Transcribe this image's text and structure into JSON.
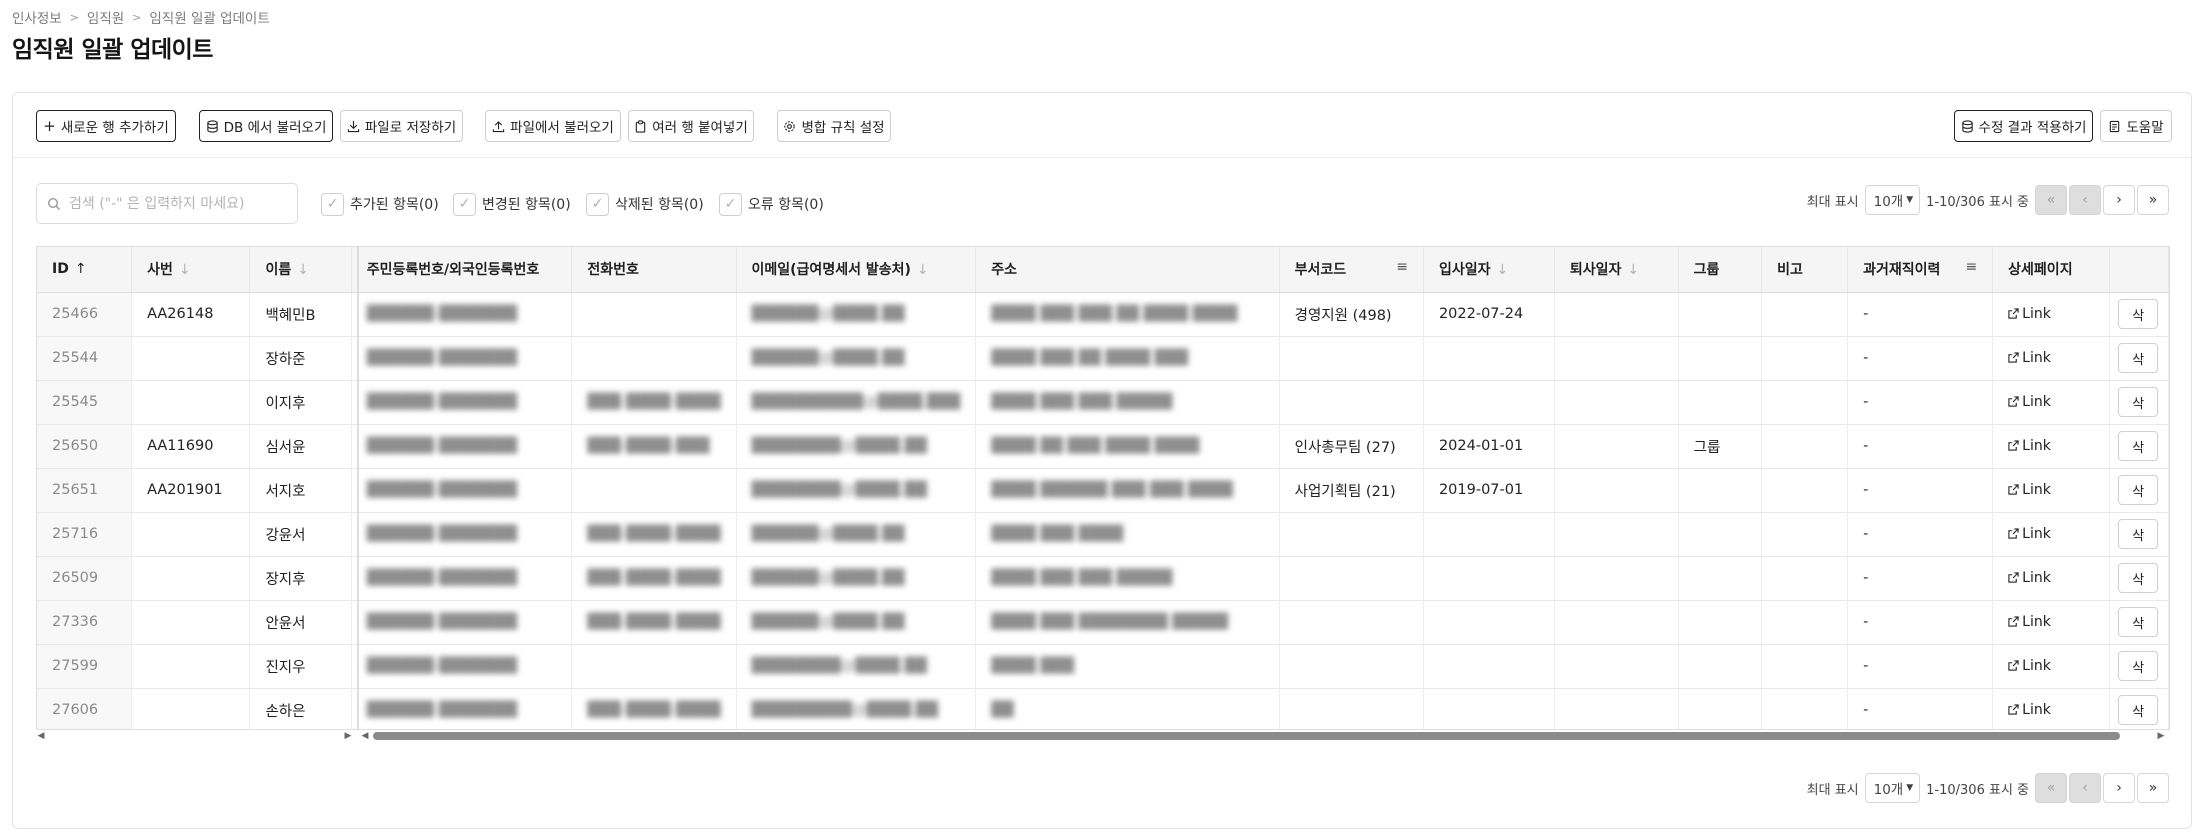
{
  "breadcrumb": [
    "인사정보",
    "임직원",
    "임직원 일괄 업데이트"
  ],
  "page_title": "임직원 일괄 업데이트",
  "toolbar": {
    "add_row": "새로운 행 추가하기",
    "load_db": "DB 에서 불러오기",
    "save_file": "파일로 저장하기",
    "load_file": "파일에서 불러오기",
    "paste_rows": "여러 행 붙여넣기",
    "merge_rules": "병합 규칙 설정",
    "apply": "수정 결과 적용하기",
    "help": "도움말"
  },
  "search": {
    "placeholder": "검색 (\"-\" 은 입력하지 마세요)"
  },
  "filters": {
    "added": "추가된 항목(0)",
    "changed": "변경된 항목(0)",
    "deleted": "삭제된 항목(0)",
    "error": "오류 항목(0)"
  },
  "pager": {
    "label": "최대 표시",
    "page_size": "10개",
    "range": "1-10/306 표시 중"
  },
  "columns": {
    "id": "ID",
    "sabun": "사번",
    "name": "이름",
    "rrn": "주민등록번호/외국인등록번호",
    "phone": "전화번호",
    "email": "이메일(급여명세서 발송처)",
    "address": "주소",
    "dept": "부서코드",
    "join": "입사일자",
    "leave": "퇴사일자",
    "group": "그룹",
    "note": "비고",
    "history": "과거재직이력",
    "detail": "상세페이지"
  },
  "rows": [
    {
      "id": "25466",
      "sabun": "AA26148",
      "name": "백혜민B",
      "rrn": "██████-███████",
      "phone": "",
      "email": "██████@████.██",
      "address": "████ ███ ███ ██ ████ ████",
      "dept": "경영지원 (498)",
      "join": "2022-07-24",
      "leave": "",
      "group": "",
      "note": "",
      "history": "-",
      "link": "Link"
    },
    {
      "id": "25544",
      "sabun": "",
      "name": "장하준",
      "rrn": "██████-███████",
      "phone": "",
      "email": "██████@████.██",
      "address": "████ ███ ██ ████ ███",
      "dept": "",
      "join": "",
      "leave": "",
      "group": "",
      "note": "",
      "history": "-",
      "link": "Link"
    },
    {
      "id": "25545",
      "sabun": "",
      "name": "이지후",
      "rrn": "██████-███████",
      "phone": "███-████-████",
      "email": "██████████@████.███",
      "address": "████ ███ ███ █████",
      "dept": "",
      "join": "",
      "leave": "",
      "group": "",
      "note": "",
      "history": "-",
      "link": "Link"
    },
    {
      "id": "25650",
      "sabun": "AA11690",
      "name": "심서윤",
      "rrn": "██████-███████",
      "phone": "███-████-███",
      "email": "████████@████.██",
      "address": "████ ██ ███ ████ ████",
      "dept": "인사총무팀 (27)",
      "join": "2024-01-01",
      "leave": "",
      "group": "그룹",
      "note": "",
      "history": "-",
      "link": "Link"
    },
    {
      "id": "25651",
      "sabun": "AA201901",
      "name": "서지호",
      "rrn": "██████-███████",
      "phone": "",
      "email": "████████@████.██",
      "address": "████ ██████ ███ ███ ████",
      "dept": "사업기획팀 (21)",
      "join": "2019-07-01",
      "leave": "",
      "group": "",
      "note": "",
      "history": "-",
      "link": "Link"
    },
    {
      "id": "25716",
      "sabun": "",
      "name": "강윤서",
      "rrn": "██████-███████",
      "phone": "███-████-████",
      "email": "██████@████.██",
      "address": "████ ███ ████",
      "dept": "",
      "join": "",
      "leave": "",
      "group": "",
      "note": "",
      "history": "-",
      "link": "Link"
    },
    {
      "id": "26509",
      "sabun": "",
      "name": "장지후",
      "rrn": "██████-███████",
      "phone": "███-████-████",
      "email": "██████@████.██",
      "address": "████ ███ ███ █████",
      "dept": "",
      "join": "",
      "leave": "",
      "group": "",
      "note": "",
      "history": "-",
      "link": "Link"
    },
    {
      "id": "27336",
      "sabun": "",
      "name": "안윤서",
      "rrn": "██████-███████",
      "phone": "███-████-████",
      "email": "██████@████.██",
      "address": "████ ███ ████████ █████",
      "dept": "",
      "join": "",
      "leave": "",
      "group": "",
      "note": "",
      "history": "-",
      "link": "Link"
    },
    {
      "id": "27599",
      "sabun": "",
      "name": "진지우",
      "rrn": "██████-███████",
      "phone": "",
      "email": "████████@████.██",
      "address": "████ ███",
      "dept": "",
      "join": "",
      "leave": "",
      "group": "",
      "note": "",
      "history": "-",
      "link": "Link"
    },
    {
      "id": "27606",
      "sabun": "",
      "name": "손하은",
      "rrn": "██████-███████",
      "phone": "███-████-████",
      "email": "█████████@████.██",
      "address": "██",
      "dept": "",
      "join": "",
      "leave": "",
      "group": "",
      "note": "",
      "history": "-",
      "link": "Link"
    }
  ],
  "delete_label": "삭"
}
